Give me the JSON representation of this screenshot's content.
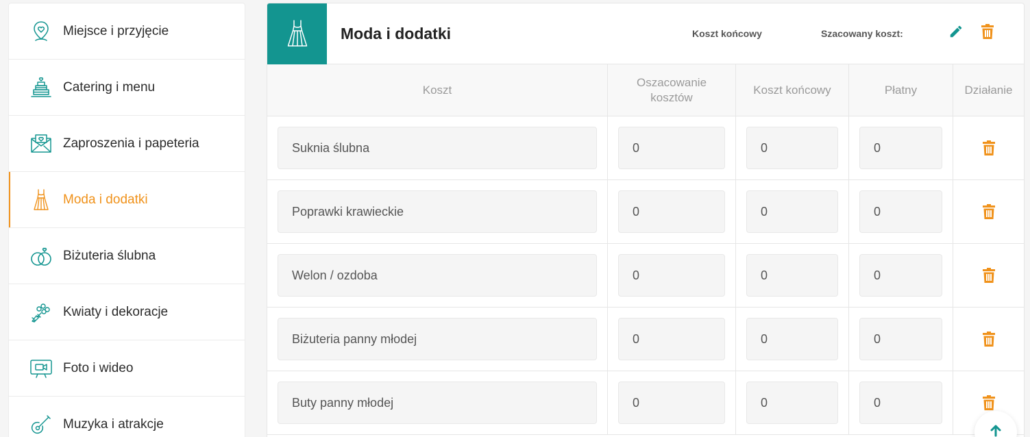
{
  "colors": {
    "accent_teal": "#139590",
    "accent_orange": "#f0921b"
  },
  "sidebar": {
    "items": [
      {
        "label": "Miejsce i przyjęcie",
        "icon": "location-heart-icon",
        "active": false
      },
      {
        "label": "Catering i menu",
        "icon": "wedding-cake-icon",
        "active": false
      },
      {
        "label": "Zaproszenia i papeteria",
        "icon": "envelope-heart-icon",
        "active": false
      },
      {
        "label": "Moda i dodatki",
        "icon": "dress-icon",
        "active": true
      },
      {
        "label": "Biżuteria ślubna",
        "icon": "rings-icon",
        "active": false
      },
      {
        "label": "Kwiaty i dekoracje",
        "icon": "bouquet-icon",
        "active": false
      },
      {
        "label": "Foto i wideo",
        "icon": "video-camera-icon",
        "active": false
      },
      {
        "label": "Muzyka i atrakcje",
        "icon": "guitar-icon",
        "active": false
      }
    ]
  },
  "panel": {
    "title": "Moda i dodatki",
    "icon": "dress-icon",
    "final_cost_label": "Koszt końcowy",
    "estimated_cost_label": "Szacowany koszt:",
    "edit_icon": "pencil-icon",
    "delete_icon": "trash-icon"
  },
  "table": {
    "headers": {
      "cost": "Koszt",
      "estimate_line1": "Oszacowanie",
      "estimate_line2": "kosztów",
      "final": "Koszt końcowy",
      "paid": "Płatny",
      "action": "Działanie"
    },
    "rows": [
      {
        "name": "Suknia ślubna",
        "estimate": "0",
        "final": "0",
        "paid": "0"
      },
      {
        "name": "Poprawki krawieckie",
        "estimate": "0",
        "final": "0",
        "paid": "0"
      },
      {
        "name": "Welon / ozdoba",
        "estimate": "0",
        "final": "0",
        "paid": "0"
      },
      {
        "name": "Biżuteria panny młodej",
        "estimate": "0",
        "final": "0",
        "paid": "0"
      },
      {
        "name": "Buty panny młodej",
        "estimate": "0",
        "final": "0",
        "paid": "0"
      }
    ]
  },
  "scroll_top_icon": "arrow-up-icon"
}
